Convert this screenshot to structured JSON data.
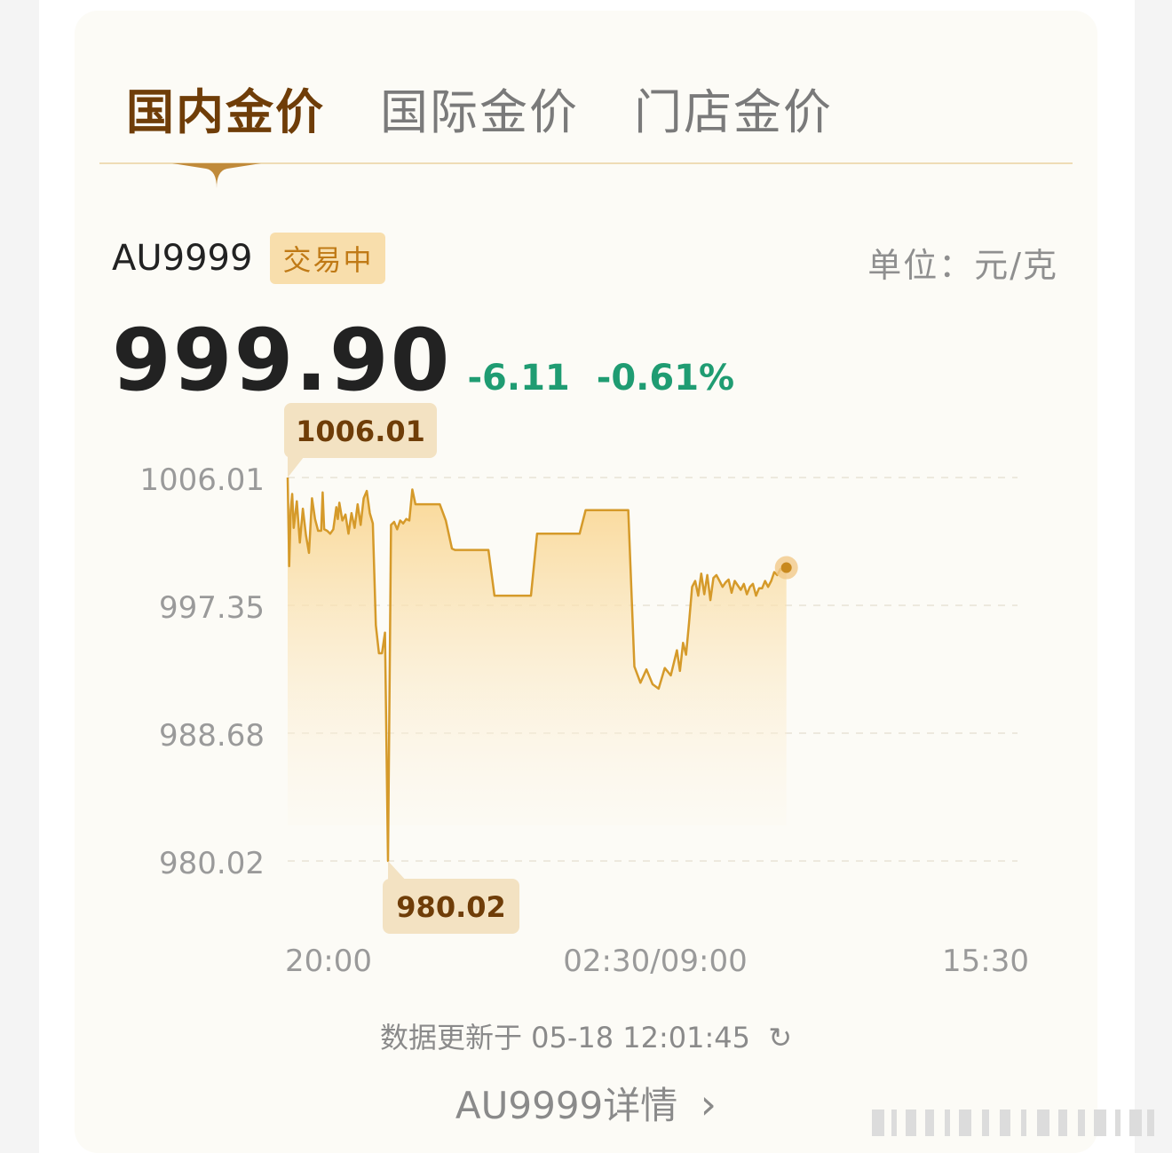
{
  "tabs": [
    {
      "label": "国内金价",
      "active": true
    },
    {
      "label": "国际金价",
      "active": false
    },
    {
      "label": "门店金价",
      "active": false
    }
  ],
  "quote": {
    "symbol": "AU9999",
    "status": "交易中",
    "unit_label": "单位：元/克",
    "price": "999.90",
    "change": "-6.11",
    "change_pct": "-0.61%"
  },
  "colors": {
    "accent_dark": "#6f3d08",
    "line": "#d59a2a",
    "fill_top": "#f9d48c",
    "fill_bottom": "#fcfbf6",
    "down": "#1f9c72",
    "badge_bg": "#f8deac",
    "badge_text": "#c07a16"
  },
  "chart_data": {
    "type": "line",
    "title": "",
    "xlabel": "",
    "ylabel": "",
    "x_ticks": [
      "20:00",
      "02:30/09:00",
      "15:30"
    ],
    "y_ticks": [
      "1006.01",
      "997.35",
      "988.68",
      "980.02"
    ],
    "ylim": [
      980.02,
      1006.01
    ],
    "grid": "horizontal dashed",
    "high_label": "1006.01",
    "low_label": "980.02",
    "series": [
      {
        "x": [
          0,
          0.5,
          1,
          1.5,
          2,
          3,
          4,
          5,
          6,
          7,
          8,
          9,
          10,
          11,
          11.5,
          12,
          13,
          14,
          15,
          16,
          16.5,
          17,
          18,
          19,
          20,
          21,
          22,
          23,
          24,
          25,
          26,
          27,
          28,
          29,
          30,
          31,
          32,
          33,
          34,
          35,
          36,
          37,
          38,
          39,
          40,
          41,
          42,
          43,
          44,
          45,
          46,
          47,
          48,
          49,
          50,
          52,
          54,
          55,
          56,
          58,
          60,
          62,
          64,
          66,
          68,
          70,
          72,
          74,
          76,
          78,
          80,
          82,
          84,
          86,
          88,
          90,
          92,
          94,
          96,
          98,
          100,
          102,
          104,
          106,
          108,
          110,
          112,
          114,
          116,
          118,
          120,
          122,
          124,
          126,
          128,
          129,
          130,
          131,
          132,
          133,
          134,
          135,
          136,
          137,
          138,
          139,
          140,
          141,
          142,
          143,
          144,
          145,
          146,
          147,
          148,
          149,
          150,
          151,
          152,
          153,
          154,
          155,
          156,
          157,
          158,
          159,
          160,
          161,
          162,
          163,
          164
        ],
        "values": [
          1006.01,
          1000.0,
          1003.8,
          1004.9,
          1002.6,
          1004.4,
          1001.6,
          1003.9,
          1002.1,
          1000.9,
          1004.6,
          1003.2,
          1002.4,
          1002.4,
          1005.0,
          1002.5,
          1002.4,
          1002.2,
          1002.5,
          1004.0,
          1003.2,
          1004.3,
          1003.1,
          1003.5,
          1002.2,
          1003.6,
          1002.6,
          1004.2,
          1002.8,
          1004.6,
          1005.1,
          1003.6,
          1002.9,
          996.0,
          994.1,
          994.1,
          995.5,
          980.02,
          1002.8,
          1003.0,
          1002.5,
          1003.1,
          1002.9,
          1003.2,
          1003.1,
          1005.2,
          1004.2,
          1004.2,
          1004.2,
          1004.2,
          1004.2,
          1004.2,
          1004.2,
          1004.2,
          1004.2,
          1003.1,
          1001.2,
          1001.1,
          1001.1,
          1001.1,
          1001.1,
          1001.1,
          1001.1,
          1001.1,
          998.0,
          998.0,
          998.0,
          998.0,
          998.0,
          998.0,
          998.0,
          1002.2,
          1002.2,
          1002.2,
          1002.2,
          1002.2,
          1002.2,
          1002.2,
          1002.2,
          1003.8,
          1003.8,
          1003.8,
          1003.8,
          1003.8,
          1003.8,
          1003.8,
          1003.8,
          993.2,
          992.1,
          993.0,
          992.0,
          991.7,
          993.1,
          992.6,
          994.3,
          992.9,
          994.8,
          994.0,
          996.2,
          998.6,
          999.0,
          998.0,
          999.5,
          998.1,
          999.4,
          997.7,
          999.2,
          999.4,
          999.0,
          998.6,
          998.9,
          999.1,
          998.2,
          999.0,
          998.7,
          998.4,
          998.8,
          998.1,
          998.6,
          998.8,
          998.0,
          998.5,
          998.5,
          999.0,
          998.6,
          999.0,
          999.6,
          999.4,
          999.8,
          999.7,
          999.9
        ],
        "x_range": [
          0,
          240
        ]
      }
    ]
  },
  "footer": {
    "update_text": "数据更新于 05-18 12:01:45",
    "detail_label": "AU9999详情"
  }
}
